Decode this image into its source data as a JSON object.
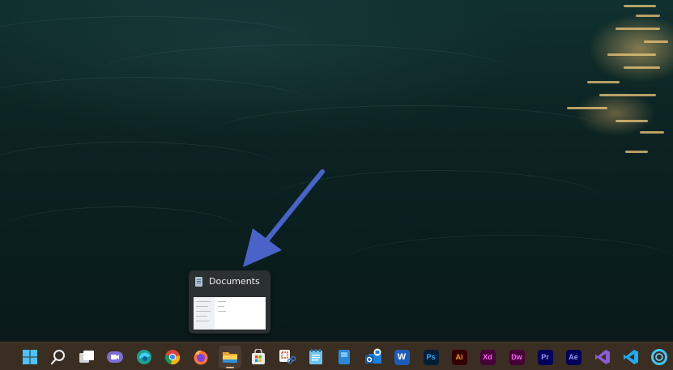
{
  "thumbnail_preview": {
    "title": "Documents"
  },
  "taskbar": {
    "items": [
      {
        "name": "start-button",
        "icon": "windows-logo-icon"
      },
      {
        "name": "search-button",
        "icon": "search-icon"
      },
      {
        "name": "task-view-button",
        "icon": "task-view-icon"
      },
      {
        "name": "teams-chat-button",
        "icon": "video-chat-icon"
      },
      {
        "name": "edge-button",
        "icon": "edge-browser-icon"
      },
      {
        "name": "chrome-button",
        "icon": "chrome-browser-icon"
      },
      {
        "name": "firefox-button",
        "icon": "firefox-browser-icon"
      },
      {
        "name": "file-explorer-button",
        "icon": "folder-icon",
        "active": true
      },
      {
        "name": "microsoft-store-button",
        "icon": "store-icon"
      },
      {
        "name": "snipping-tool-button",
        "icon": "snipping-tool-icon"
      },
      {
        "name": "notepad-button",
        "icon": "notepad-icon"
      },
      {
        "name": "app-button",
        "icon": "blue-app-icon"
      },
      {
        "name": "outlook-button",
        "icon": "outlook-mail-icon"
      },
      {
        "name": "word-button",
        "icon": "word-icon",
        "label": "W"
      },
      {
        "name": "photoshop-button",
        "icon": "photoshop-icon",
        "label": "Ps"
      },
      {
        "name": "illustrator-button",
        "icon": "illustrator-icon",
        "label": "Ai"
      },
      {
        "name": "xd-button",
        "icon": "adobe-xd-icon",
        "label": "Xd"
      },
      {
        "name": "dreamweaver-button",
        "icon": "dreamweaver-icon",
        "label": "Dw"
      },
      {
        "name": "premiere-button",
        "icon": "premiere-pro-icon",
        "label": "Pr"
      },
      {
        "name": "after-effects-button",
        "icon": "after-effects-icon",
        "label": "Ae"
      },
      {
        "name": "visual-studio-button",
        "icon": "visual-studio-icon"
      },
      {
        "name": "vscode-button",
        "icon": "vscode-icon"
      },
      {
        "name": "cortana-button",
        "icon": "cortana-icon"
      }
    ]
  },
  "colors": {
    "taskbar": "#3a2d22",
    "arrow": "#4a63c8",
    "preview_bg": "#2b3030",
    "photoshop": "#31a8ff",
    "illustrator": "#ff9a00",
    "xd": "#ff61f6",
    "dreamweaver": "#ff61f6",
    "premiere": "#9999ff",
    "after_effects": "#9999ff"
  }
}
